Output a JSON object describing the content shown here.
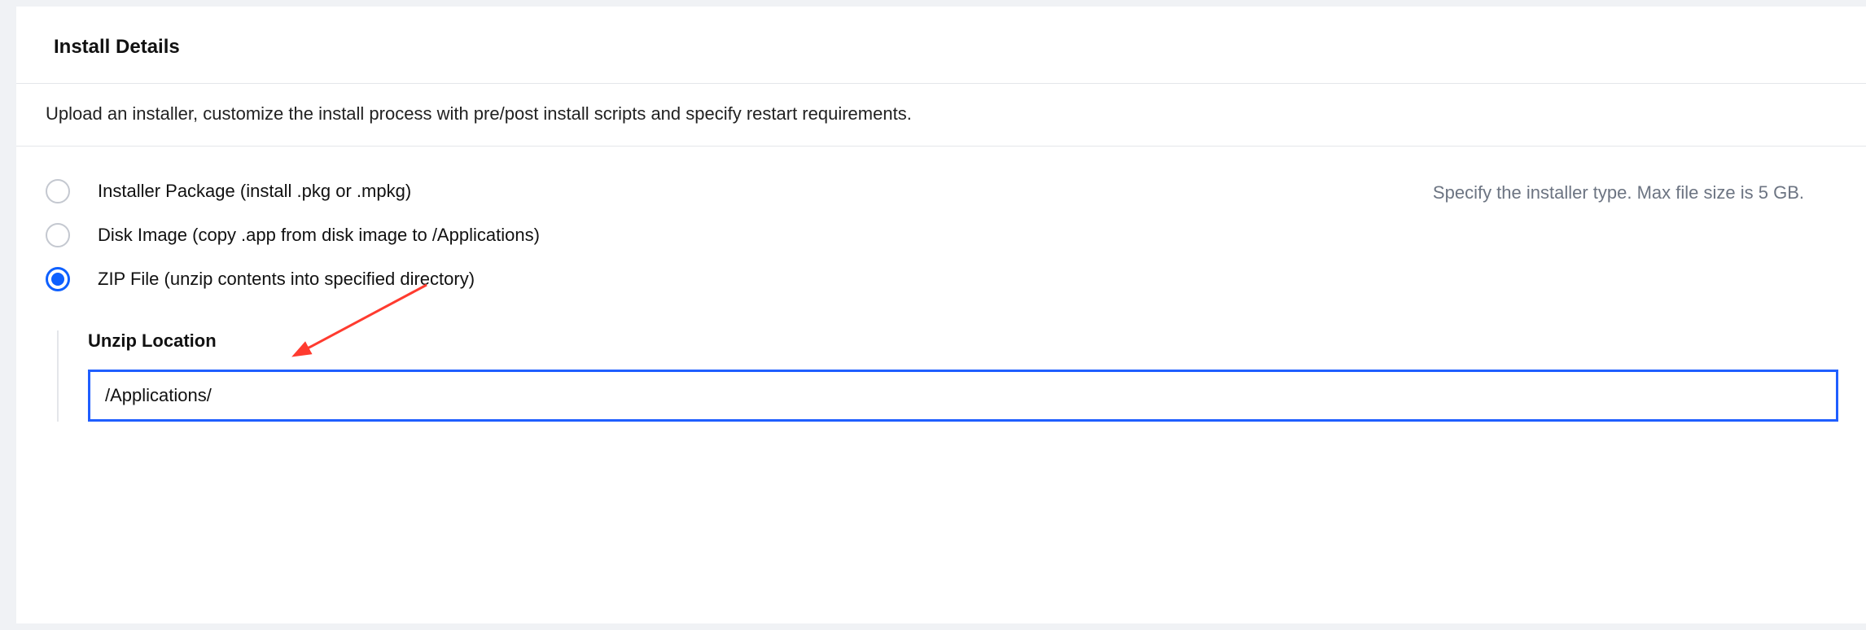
{
  "section": {
    "title": "Install Details",
    "description": "Upload an installer, customize the install process with pre/post install scripts and specify restart requirements."
  },
  "hint": "Specify the installer type. Max file size is 5 GB.",
  "radios": [
    {
      "label": "Installer Package (install .pkg or .mpkg)",
      "checked": false
    },
    {
      "label": "Disk Image (copy .app from disk image to /Applications)",
      "checked": false
    },
    {
      "label": "ZIP File (unzip contents into specified directory)",
      "checked": true
    }
  ],
  "unzip": {
    "label": "Unzip Location",
    "value": "/Applications/"
  }
}
